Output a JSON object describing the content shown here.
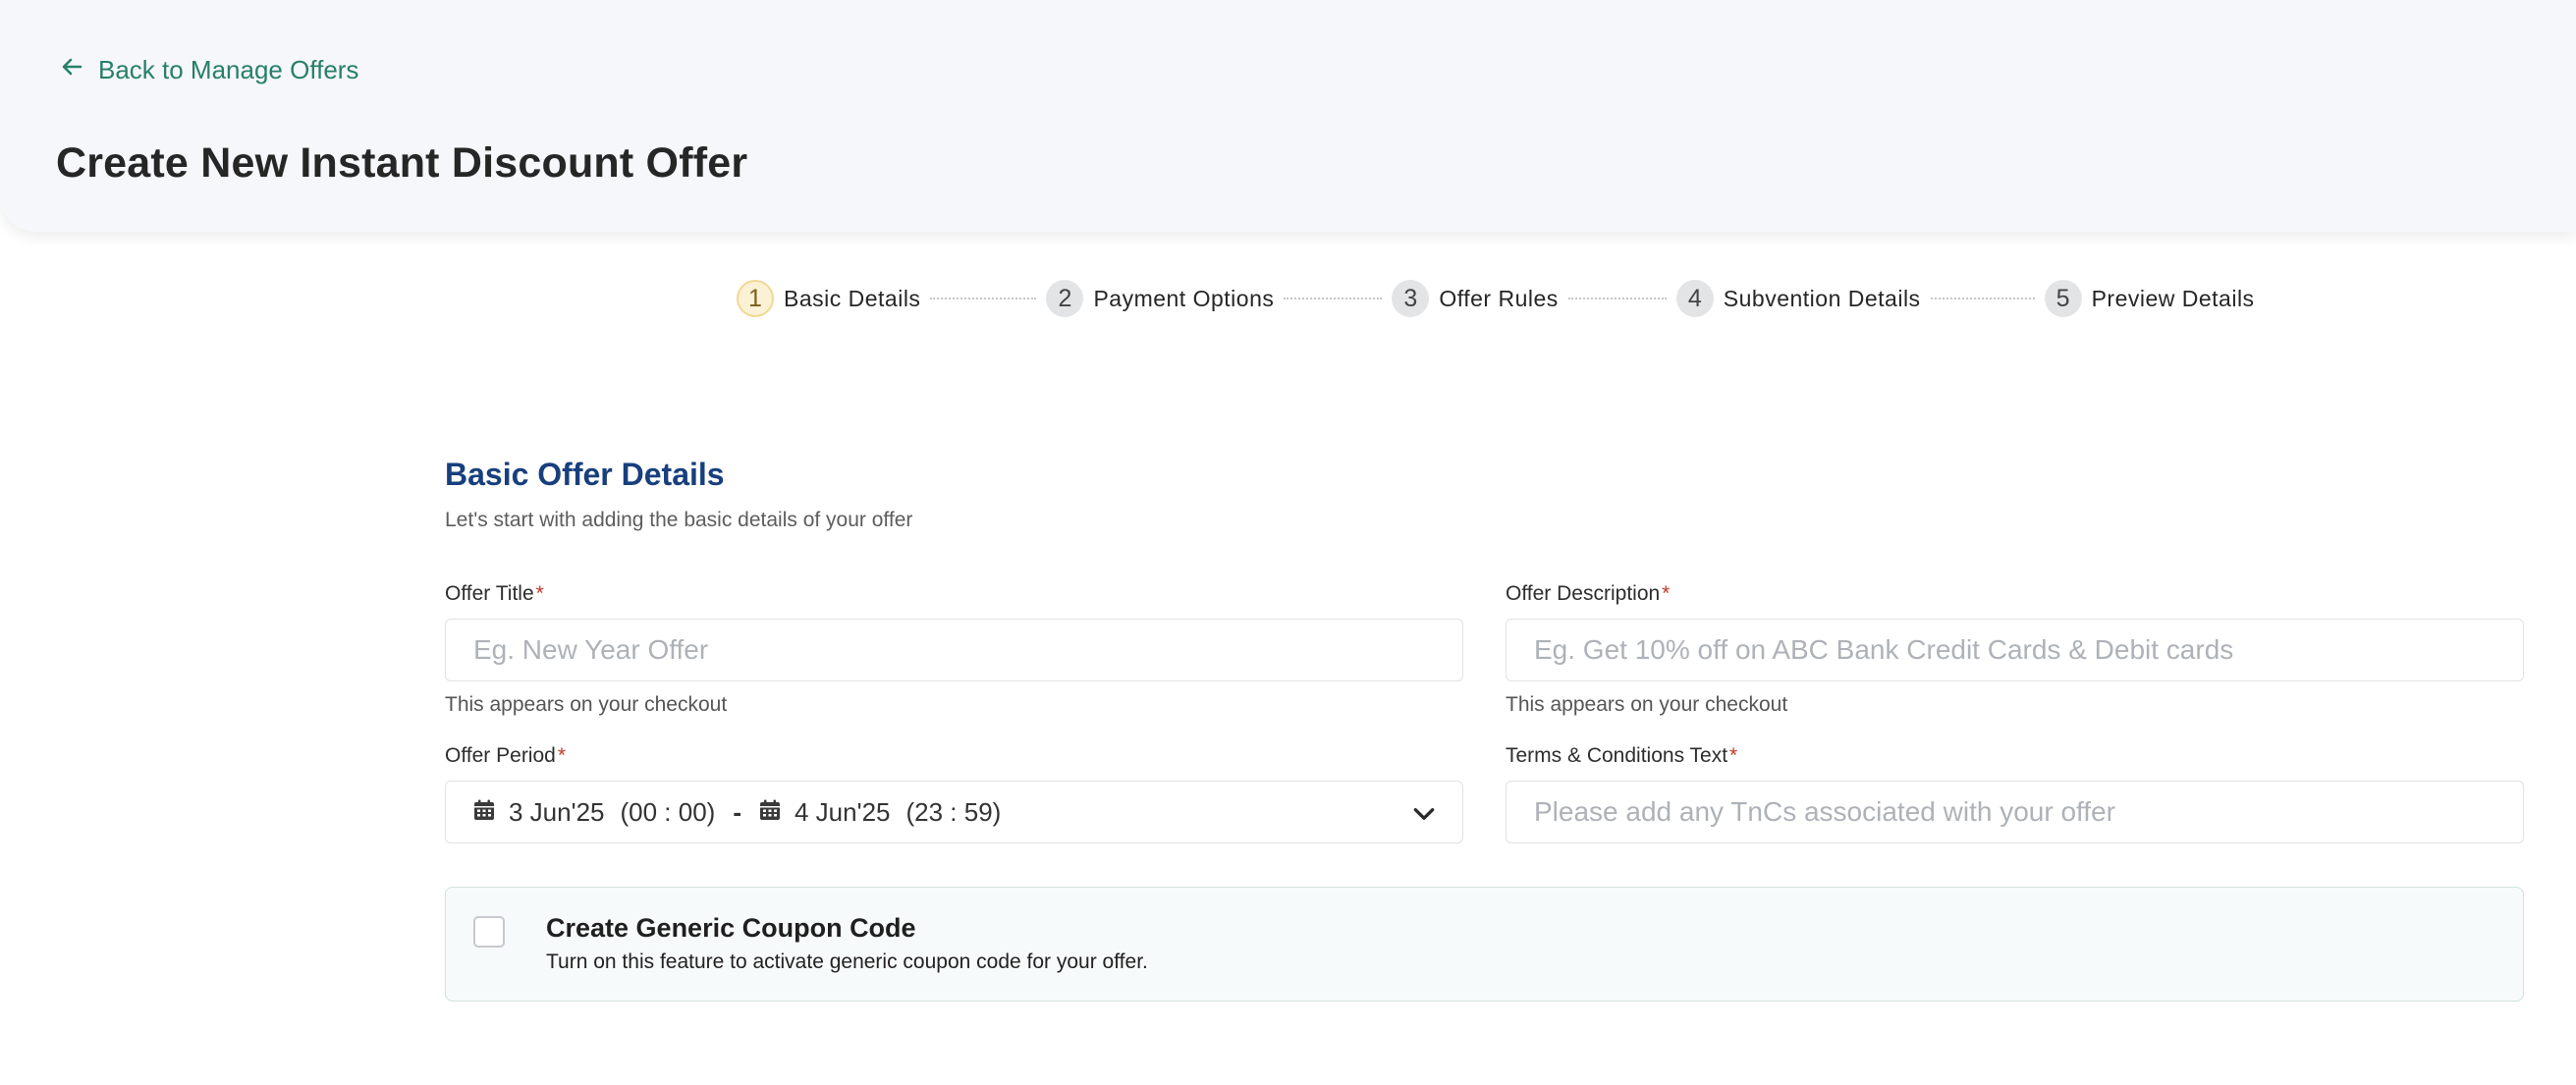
{
  "header": {
    "back_label": "Back to Manage Offers",
    "title": "Create New Instant Discount Offer"
  },
  "stepper": {
    "steps": [
      {
        "num": "1",
        "label": "Basic Details",
        "active": true
      },
      {
        "num": "2",
        "label": "Payment Options",
        "active": false
      },
      {
        "num": "3",
        "label": "Offer Rules",
        "active": false
      },
      {
        "num": "4",
        "label": "Subvention Details",
        "active": false
      },
      {
        "num": "5",
        "label": "Preview Details",
        "active": false
      }
    ]
  },
  "section": {
    "title": "Basic Offer Details",
    "subtitle": "Let's start with adding the basic details of your offer"
  },
  "form": {
    "offer_title": {
      "label": "Offer Title",
      "required": "*",
      "placeholder": "Eg. New Year Offer",
      "value": "",
      "hint": "This appears on your checkout"
    },
    "offer_description": {
      "label": "Offer Description",
      "required": "*",
      "placeholder": "Eg. Get 10% off on ABC Bank Credit Cards & Debit cards",
      "value": "",
      "hint": "This appears on your checkout"
    },
    "offer_period": {
      "label": "Offer Period",
      "required": "*",
      "start_date": "3 Jun'25",
      "start_time": "(00 : 00)",
      "separator": "-",
      "end_date": "4 Jun'25",
      "end_time": "(23 : 59)"
    },
    "terms": {
      "label": "Terms & Conditions Text",
      "required": "*",
      "placeholder": "Please add any TnCs associated with your offer",
      "value": ""
    }
  },
  "coupon": {
    "title": "Create Generic Coupon Code",
    "description": "Turn on this feature to activate generic coupon code for your offer.",
    "checked": false
  },
  "colors": {
    "accent_green": "#277f6a",
    "section_title_blue": "#183f7d",
    "required_red": "#c0392b",
    "header_bg": "#f6f7fb"
  },
  "icons": [
    "arrow-left-icon",
    "calendar-icon",
    "chevron-down-icon"
  ]
}
